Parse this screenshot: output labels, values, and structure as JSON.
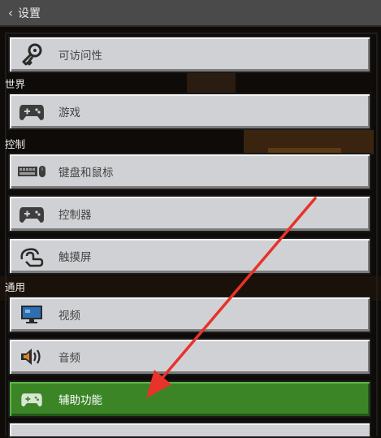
{
  "header": {
    "back_glyph": "‹",
    "title": "设置"
  },
  "sections": {
    "world": "世界",
    "controls": "控制",
    "general": "通用"
  },
  "items": [
    {
      "label": "可访问性",
      "icon": "key-icon"
    },
    {
      "label": "游戏",
      "icon": "gamepad-icon"
    },
    {
      "label": "键盘和鼠标",
      "icon": "keyboard-mouse-icon"
    },
    {
      "label": "控制器",
      "icon": "gamepad-icon"
    },
    {
      "label": "触摸屏",
      "icon": "touch-icon"
    },
    {
      "label": "视频",
      "icon": "monitor-icon"
    },
    {
      "label": "音频",
      "icon": "speaker-icon"
    },
    {
      "label": "辅助功能",
      "icon": "gamepad-icon",
      "selected": true
    }
  ],
  "colors": {
    "selected": "#3c8527",
    "button": "#d0d1d4",
    "arrow": "#e8322a",
    "header": "#4a4a4a"
  }
}
